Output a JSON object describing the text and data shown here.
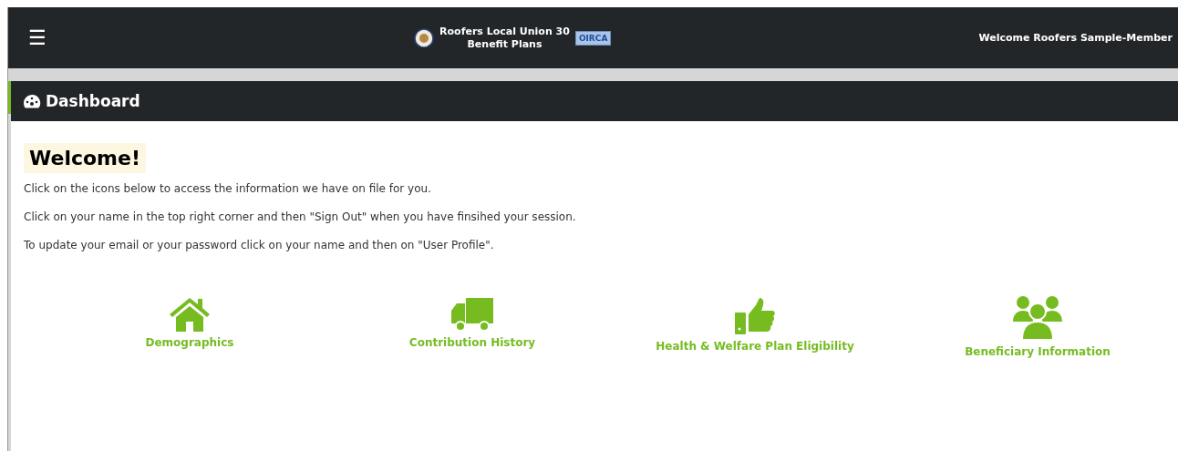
{
  "header": {
    "menu_icon": "☰",
    "brand_line_1": "Roofers Local Union 30",
    "brand_line_2": "Benefit Plans",
    "brand_badge": "OIRCA",
    "user": "Welcome Roofers Sample-Member"
  },
  "panel": {
    "title": "Dashboard",
    "heading": "Welcome!",
    "paragraphs": [
      "Click on the icons below to access the information we have on file for you.",
      "Click on your name in the top right corner and then \"Sign Out\" when you have finsihed your session.",
      "To update your email or your password click on your name and then on \"User Profile\"."
    ],
    "tiles": [
      {
        "kind": "house",
        "label": "Demographics"
      },
      {
        "kind": "truck",
        "label": "Contribution History"
      },
      {
        "kind": "thumb",
        "label": "Health & Welfare Plan Eligibility"
      },
      {
        "kind": "users",
        "label": "Beneficiary Information"
      }
    ]
  }
}
